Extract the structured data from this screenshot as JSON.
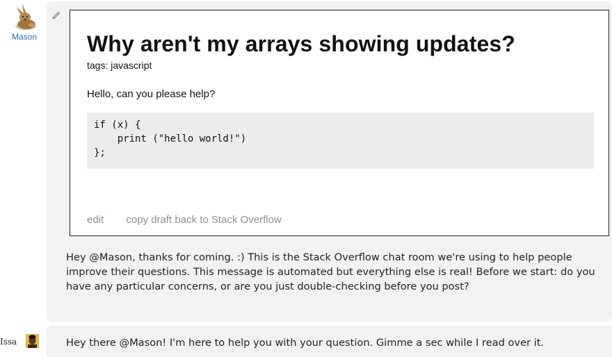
{
  "messages": [
    {
      "user": "Mason",
      "onebox": {
        "title": "Why aren't my arrays showing updates?",
        "tags_label": "tags:",
        "tags": [
          "javascript"
        ],
        "body": "Hello, can you please help?",
        "code": "if (x) {\n    print (\"hello world!\")\n};",
        "actions": {
          "edit": "edit",
          "copy_back": "copy draft back to Stack Overflow"
        }
      },
      "followup": "Hey @Mason, thanks for coming. :) This is the Stack Overflow chat room we're using to help people improve their questions. This message is automated but everything else is real! Before we start: do you have any particular concerns, or are you just double-checking before you post?"
    },
    {
      "user": "Issa",
      "text": "Hey there @Mason! I'm here to help you with your question. Gimme a sec while I read over it."
    }
  ],
  "icons": {
    "mason_avatar": "rabbit-avatar-icon",
    "issa_avatar": "person-avatar-icon",
    "edit": "pencil-icon"
  },
  "colors": {
    "username_link": "#2a6bb6",
    "message_bg": "#f2f2f2",
    "action_link": "#8a9199",
    "code_bg": "#ececec"
  }
}
